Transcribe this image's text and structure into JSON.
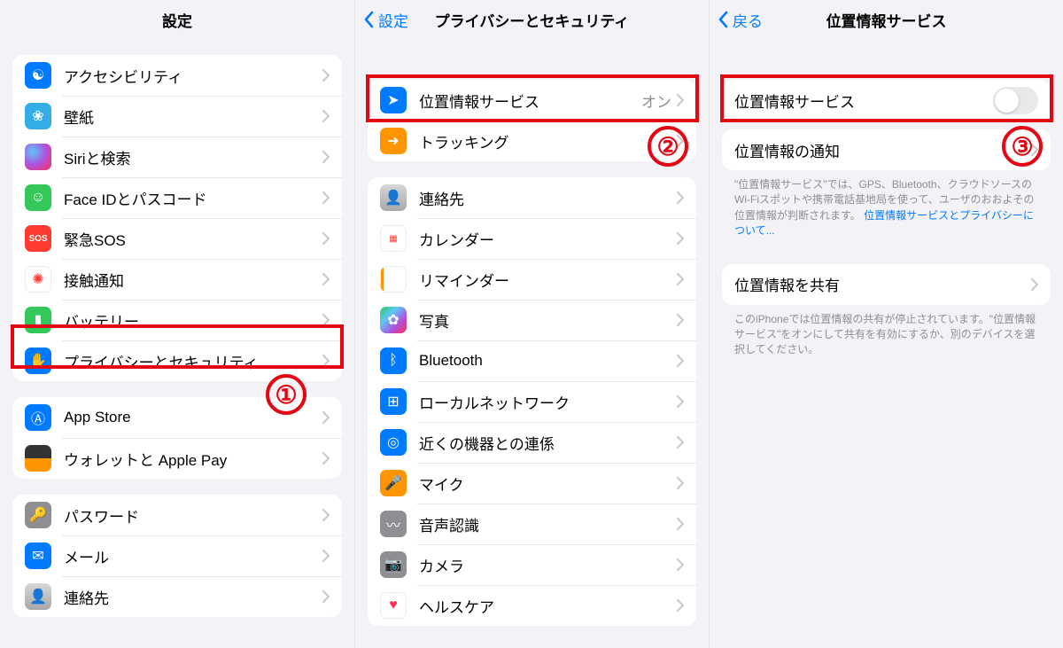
{
  "col1": {
    "title": "設定",
    "group1": [
      {
        "label": "アクセシビリティ",
        "iconName": "accessibility-icon",
        "bg": "bg-blue"
      },
      {
        "label": "壁紙",
        "iconName": "wallpaper-icon",
        "bg": "bg-lblue"
      },
      {
        "label": "Siriと検索",
        "iconName": "siri-icon",
        "bg": "bg-black"
      },
      {
        "label": "Face IDとパスコード",
        "iconName": "faceid-icon",
        "bg": "bg-green"
      },
      {
        "label": "緊急SOS",
        "iconName": "sos-icon",
        "bg": "bg-red"
      },
      {
        "label": "接触通知",
        "iconName": "exposure-icon",
        "bg": "bg-exposure"
      },
      {
        "label": "バッテリー",
        "iconName": "battery-icon",
        "bg": "bg-green"
      },
      {
        "label": "プライバシーとセキュリティ",
        "iconName": "privacy-icon",
        "bg": "bg-blue"
      }
    ],
    "group2": [
      {
        "label": "App Store",
        "iconName": "appstore-icon",
        "bg": "bg-blue"
      },
      {
        "label": "ウォレットと Apple Pay",
        "iconName": "wallet-icon",
        "bg": "bg-black"
      }
    ],
    "group3": [
      {
        "label": "パスワード",
        "iconName": "passwords-icon",
        "bg": "bg-gray"
      },
      {
        "label": "メール",
        "iconName": "mail-icon",
        "bg": "bg-blue"
      },
      {
        "label": "連絡先",
        "iconName": "contacts-icon",
        "bg": "bg-gray"
      }
    ],
    "step": "①"
  },
  "col2": {
    "back": "設定",
    "title": "プライバシーとセキュリティ",
    "group1": [
      {
        "label": "位置情報サービス",
        "iconName": "location-icon",
        "bg": "bg-blue",
        "value": "オン"
      },
      {
        "label": "トラッキング",
        "iconName": "tracking-icon",
        "bg": "bg-orange"
      }
    ],
    "group2": [
      {
        "label": "連絡先",
        "iconName": "contacts-icon",
        "bg": "bg-gray"
      },
      {
        "label": "カレンダー",
        "iconName": "calendar-icon",
        "bg": "bg-white"
      },
      {
        "label": "リマインダー",
        "iconName": "reminders-icon",
        "bg": "bg-white"
      },
      {
        "label": "写真",
        "iconName": "photos-icon",
        "bg": "bg-multi"
      },
      {
        "label": "Bluetooth",
        "iconName": "bluetooth-icon",
        "bg": "bg-blue"
      },
      {
        "label": "ローカルネットワーク",
        "iconName": "localnet-icon",
        "bg": "bg-blue"
      },
      {
        "label": "近くの機器との連係",
        "iconName": "nearby-icon",
        "bg": "bg-blue"
      },
      {
        "label": "マイク",
        "iconName": "mic-icon",
        "bg": "bg-orange"
      },
      {
        "label": "音声認識",
        "iconName": "speech-icon",
        "bg": "bg-gray"
      },
      {
        "label": "カメラ",
        "iconName": "camera-icon",
        "bg": "bg-gray"
      },
      {
        "label": "ヘルスケア",
        "iconName": "health-icon",
        "bg": "bg-white"
      }
    ],
    "step": "②"
  },
  "col3": {
    "back": "戻る",
    "title": "位置情報サービス",
    "row1_label": "位置情報サービス",
    "row2_label": "位置情報の通知",
    "foot1_a": "\"位置情報サービス\"では、GPS、Bluetooth、クラウドソースのWi-Fiスポットや携帯電話基地局を使って、ユーザのおおよその位置情報が判断されます。",
    "foot1_link": "位置情報サービスとプライバシーについて...",
    "row3_label": "位置情報を共有",
    "foot2": "このiPhoneでは位置情報の共有が停止されています。\"位置情報サービス\"をオンにして共有を有効にするか、別のデバイスを選択してください。",
    "step": "③"
  }
}
